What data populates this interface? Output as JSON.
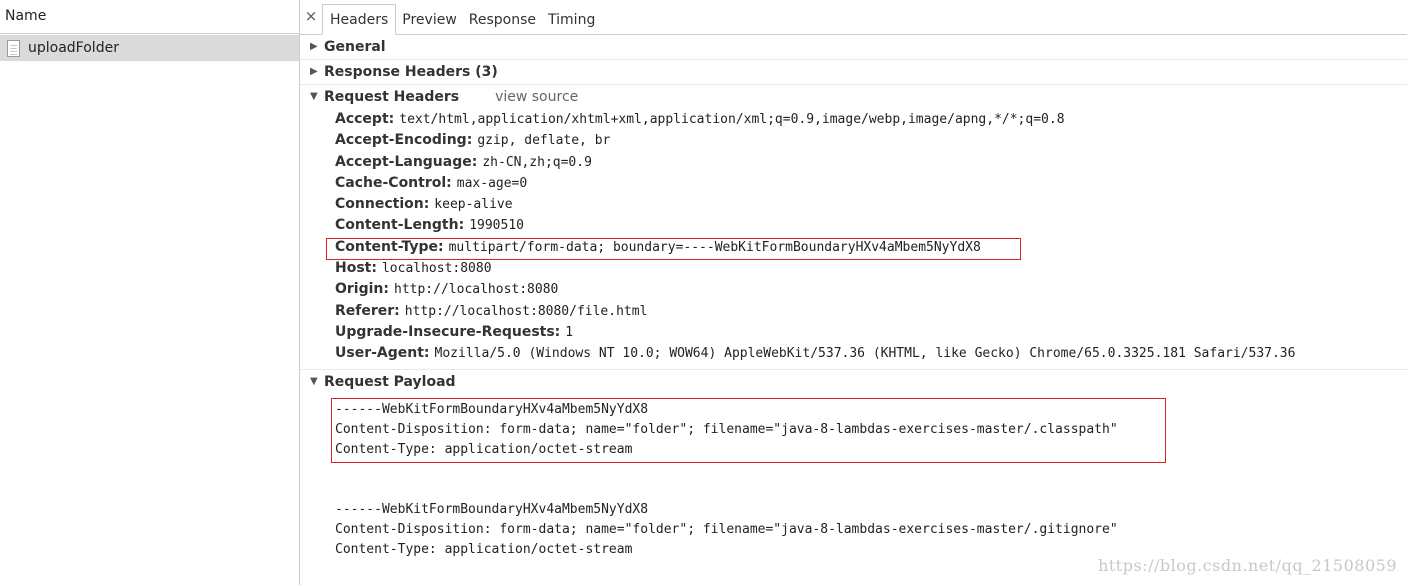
{
  "left": {
    "column_header": "Name",
    "files": [
      {
        "name": "uploadFolder",
        "icon": "document-icon"
      }
    ]
  },
  "tabs": {
    "close_label": "×",
    "items": [
      "Headers",
      "Preview",
      "Response",
      "Timing"
    ],
    "active": "Headers"
  },
  "sections": {
    "general": {
      "title": "General",
      "expanded": false
    },
    "response_headers": {
      "title": "Response Headers (3)",
      "expanded": false
    },
    "request_headers": {
      "title": "Request Headers",
      "view_source": "view source",
      "expanded": true,
      "items": [
        {
          "key": "Accept:",
          "value": "text/html,application/xhtml+xml,application/xml;q=0.9,image/webp,image/apng,*/*;q=0.8"
        },
        {
          "key": "Accept-Encoding:",
          "value": "gzip, deflate, br"
        },
        {
          "key": "Accept-Language:",
          "value": "zh-CN,zh;q=0.9"
        },
        {
          "key": "Cache-Control:",
          "value": "max-age=0"
        },
        {
          "key": "Connection:",
          "value": "keep-alive"
        },
        {
          "key": "Content-Length:",
          "value": "1990510"
        },
        {
          "key": "Content-Type:",
          "value": "multipart/form-data; boundary=----WebKitFormBoundaryHXv4aMbem5NyYdX8"
        },
        {
          "key": "Host:",
          "value": "localhost:8080"
        },
        {
          "key": "Origin:",
          "value": "http://localhost:8080"
        },
        {
          "key": "Referer:",
          "value": "http://localhost:8080/file.html"
        },
        {
          "key": "Upgrade-Insecure-Requests:",
          "value": "1"
        },
        {
          "key": "User-Agent:",
          "value": "Mozilla/5.0 (Windows NT 10.0; WOW64) AppleWebKit/537.36 (KHTML, like Gecko) Chrome/65.0.3325.181 Safari/537.36"
        }
      ]
    },
    "request_payload": {
      "title": "Request Payload",
      "expanded": true,
      "lines_block1": [
        "------WebKitFormBoundaryHXv4aMbem5NyYdX8",
        "Content-Disposition: form-data; name=\"folder\"; filename=\"java-8-lambdas-exercises-master/.classpath\"",
        "Content-Type: application/octet-stream"
      ],
      "lines_block2": [
        "------WebKitFormBoundaryHXv4aMbem5NyYdX8",
        "Content-Disposition: form-data; name=\"folder\"; filename=\"java-8-lambdas-exercises-master/.gitignore\"",
        "Content-Type: application/octet-stream"
      ]
    }
  },
  "watermark": "https://blog.csdn.net/qq_21508059",
  "colors": {
    "highlight_box": "#dd2222",
    "selected_row": "#dadada"
  }
}
